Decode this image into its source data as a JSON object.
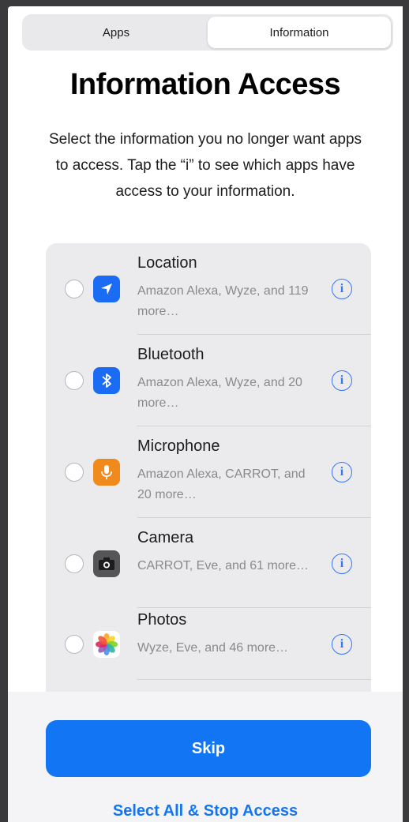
{
  "segmented_control": {
    "tabs": [
      "Apps",
      "Information"
    ],
    "selected": "Information"
  },
  "header": {
    "title": "Information Access",
    "subtitle": "Select the information you no longer want apps to access. Tap the “i” to see which apps have access to your information."
  },
  "info_list": [
    {
      "name": "Location",
      "desc": "Amazon Alexa, Wyze, and 119 more…",
      "icon": "location-arrow-icon",
      "icon_bg": "#1a6cf5"
    },
    {
      "name": "Bluetooth",
      "desc": "Amazon Alexa, Wyze, and 20 more…",
      "icon": "bluetooth-icon",
      "icon_bg": "#1a6cf5"
    },
    {
      "name": "Microphone",
      "desc": "Amazon Alexa, CARROT, and 20 more…",
      "icon": "microphone-icon",
      "icon_bg": "#f08a1c"
    },
    {
      "name": "Camera",
      "desc": "CARROT, Eve, and 61 more…",
      "icon": "camera-icon",
      "icon_bg": "#555558"
    },
    {
      "name": "Photos",
      "desc": "Wyze, Eve, and 46 more…",
      "icon": "photos-icon",
      "icon_bg": "#ffffff"
    }
  ],
  "actions": {
    "skip": "Skip",
    "select_all": "Select All & Stop Access"
  },
  "colors": {
    "accent": "#1275f4",
    "background": "#ffffff",
    "list_bg": "#ebebed"
  }
}
